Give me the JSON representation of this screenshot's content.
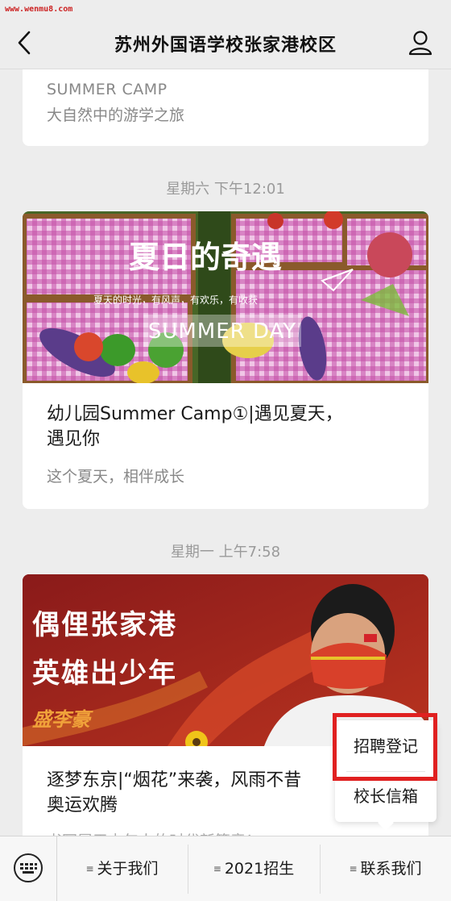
{
  "watermark": "www.wenmu8.com",
  "header": {
    "title": "苏州外国语学校张家港校区"
  },
  "feed": {
    "card1": {
      "subtitle_en": "SUMMER CAMP",
      "subtitle_cn": "大自然中的游学之旅"
    },
    "timestamp1": "星期六 下午12:01",
    "card2": {
      "cover_title": "夏日的奇遇",
      "cover_subline": "夏天的时光，有风声，有欢乐，有收获",
      "cover_banner": "SUMMER DAY",
      "title_line1": "幼儿园Summer Camp①|遇见夏天，",
      "title_line2": "遇见你",
      "digest": "这个夏天，相伴成长"
    },
    "timestamp2": "星期一 上午7:58",
    "card3": {
      "cover_line1": "偶俚张家港",
      "cover_line2": "英雄出少年",
      "cover_name": "盛李豪",
      "title_line1": "逐梦东京|“烟花”来袭，风雨不昔",
      "title_line2": "奥运欢腾",
      "digest": "书写属于少年人的时代新篇章！"
    }
  },
  "popup_menu": {
    "items": [
      "招聘登记",
      "校长信箱"
    ]
  },
  "bottom_menu": {
    "items": [
      {
        "label": "关于我们",
        "icon": "menu-lines-icon"
      },
      {
        "label": "2021招生",
        "icon": "menu-lines-icon"
      },
      {
        "label": "联系我们",
        "icon": "menu-lines-icon"
      }
    ]
  },
  "colors": {
    "highlight": "#e02020",
    "background": "#ededed"
  }
}
